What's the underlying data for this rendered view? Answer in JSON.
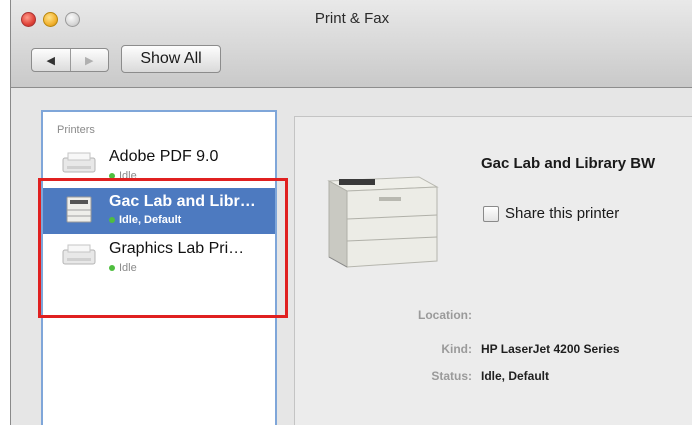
{
  "window": {
    "title": "Print & Fax",
    "show_all_label": "Show All",
    "back_glyph": "◀",
    "forward_glyph": "▶"
  },
  "sidebar": {
    "heading": "Printers",
    "items": [
      {
        "name": "Adobe PDF 9.0",
        "status": "Idle",
        "selected": false
      },
      {
        "name": "Gac Lab and Libr…",
        "status": "Idle, Default",
        "selected": true
      },
      {
        "name": "Graphics Lab Pri…",
        "status": "Idle",
        "selected": false
      }
    ]
  },
  "detail": {
    "printer_name": "Gac Lab and Library BW",
    "share_label": "Share this printer",
    "share_checked": false,
    "location_label": "Location:",
    "location_value": "",
    "kind_label": "Kind:",
    "kind_value": "HP LaserJet 4200 Series",
    "status_label": "Status:",
    "status_value": "Idle, Default"
  },
  "colors": {
    "selection": "#4d7ac0",
    "status_dot": "#4fbe3f",
    "highlight": "#e02020"
  }
}
